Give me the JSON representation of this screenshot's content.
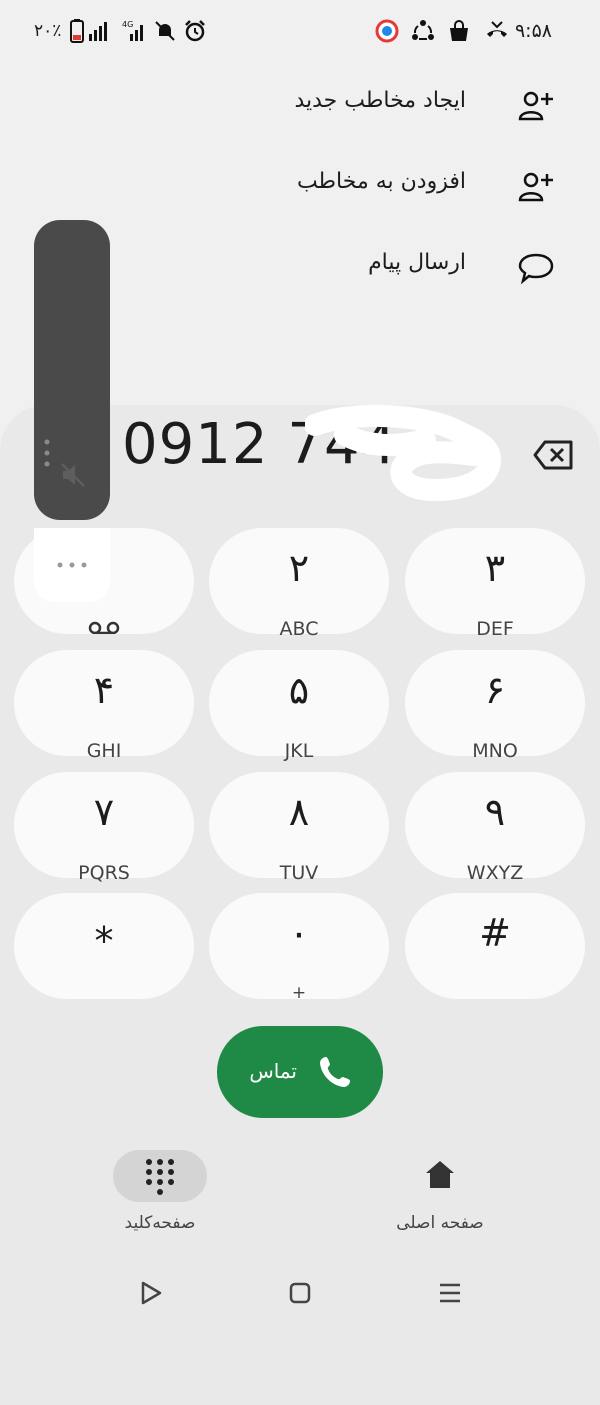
{
  "status_bar": {
    "time": "۹:۵۸",
    "battery_percent": "۲۰٪",
    "network": "4G"
  },
  "menu": {
    "items": [
      {
        "label": "ایجاد مخاطب جدید",
        "icon": "add-person-icon"
      },
      {
        "label": "افزودن به مخاطب",
        "icon": "add-person-icon"
      },
      {
        "label": "ارسال پیام",
        "icon": "message-bubble-icon"
      }
    ]
  },
  "dialer": {
    "number": "0912 744 ",
    "keys": [
      {
        "digit": "",
        "letters": ""
      },
      {
        "digit": "۲",
        "letters": "ABC"
      },
      {
        "digit": "۳",
        "letters": "DEF"
      },
      {
        "digit": "۴",
        "letters": "GHI"
      },
      {
        "digit": "۵",
        "letters": "JKL"
      },
      {
        "digit": "۶",
        "letters": "MNO"
      },
      {
        "digit": "۷",
        "letters": "PQRS"
      },
      {
        "digit": "۸",
        "letters": "TUV"
      },
      {
        "digit": "۹",
        "letters": "WXYZ"
      },
      {
        "digit": "*",
        "letters": ""
      },
      {
        "digit": "۰",
        "letters": "+"
      },
      {
        "digit": "#",
        "letters": ""
      }
    ],
    "call_label": "تماس",
    "call_color": "#1f8a45"
  },
  "bottom_nav": {
    "keypad_label": "صفحه‌کلید",
    "home_label": "صفحه اصلی"
  }
}
